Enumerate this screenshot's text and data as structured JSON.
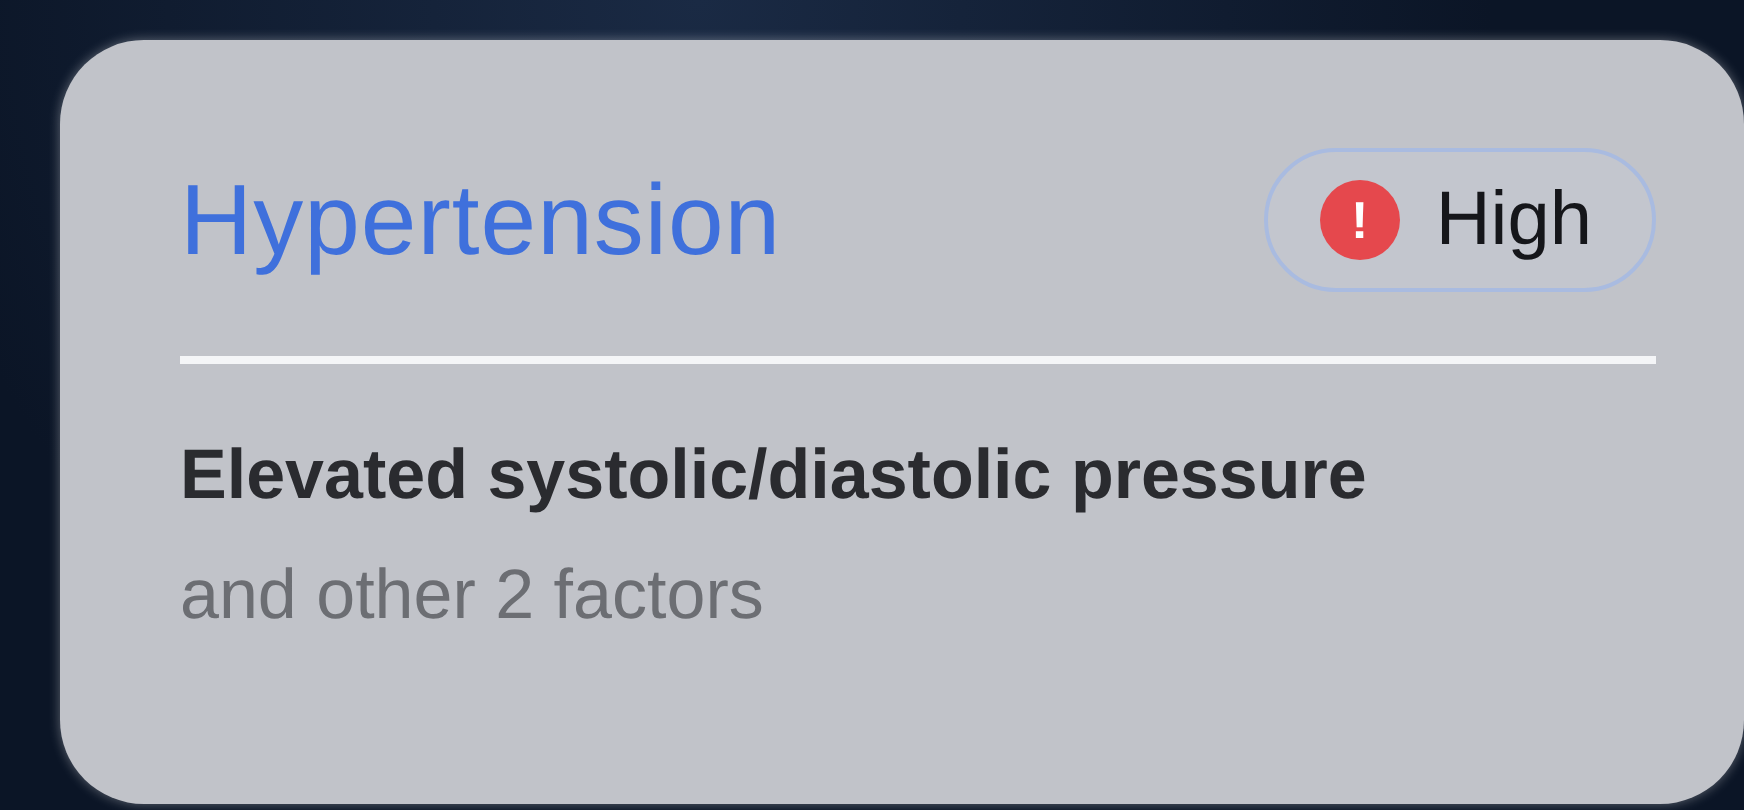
{
  "card": {
    "title": "Hypertension",
    "badge": {
      "icon": "!",
      "label": "High"
    },
    "summary": "Elevated systolic/diastolic pressure",
    "detail": "and other 2 factors"
  }
}
